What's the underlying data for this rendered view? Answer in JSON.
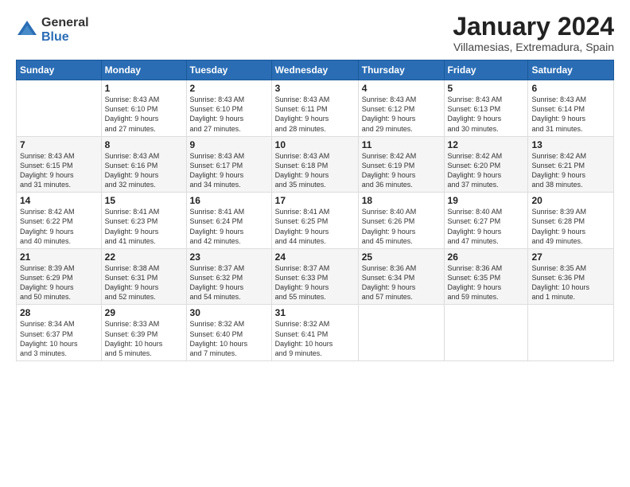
{
  "logo": {
    "general": "General",
    "blue": "Blue"
  },
  "title": "January 2024",
  "subtitle": "Villamesias, Extremadura, Spain",
  "weekdays": [
    "Sunday",
    "Monday",
    "Tuesday",
    "Wednesday",
    "Thursday",
    "Friday",
    "Saturday"
  ],
  "weeks": [
    [
      {
        "day": "",
        "info": ""
      },
      {
        "day": "1",
        "info": "Sunrise: 8:43 AM\nSunset: 6:10 PM\nDaylight: 9 hours\nand 27 minutes."
      },
      {
        "day": "2",
        "info": "Sunrise: 8:43 AM\nSunset: 6:10 PM\nDaylight: 9 hours\nand 27 minutes."
      },
      {
        "day": "3",
        "info": "Sunrise: 8:43 AM\nSunset: 6:11 PM\nDaylight: 9 hours\nand 28 minutes."
      },
      {
        "day": "4",
        "info": "Sunrise: 8:43 AM\nSunset: 6:12 PM\nDaylight: 9 hours\nand 29 minutes."
      },
      {
        "day": "5",
        "info": "Sunrise: 8:43 AM\nSunset: 6:13 PM\nDaylight: 9 hours\nand 30 minutes."
      },
      {
        "day": "6",
        "info": "Sunrise: 8:43 AM\nSunset: 6:14 PM\nDaylight: 9 hours\nand 31 minutes."
      }
    ],
    [
      {
        "day": "7",
        "info": "Sunrise: 8:43 AM\nSunset: 6:15 PM\nDaylight: 9 hours\nand 31 minutes."
      },
      {
        "day": "8",
        "info": "Sunrise: 8:43 AM\nSunset: 6:16 PM\nDaylight: 9 hours\nand 32 minutes."
      },
      {
        "day": "9",
        "info": "Sunrise: 8:43 AM\nSunset: 6:17 PM\nDaylight: 9 hours\nand 34 minutes."
      },
      {
        "day": "10",
        "info": "Sunrise: 8:43 AM\nSunset: 6:18 PM\nDaylight: 9 hours\nand 35 minutes."
      },
      {
        "day": "11",
        "info": "Sunrise: 8:42 AM\nSunset: 6:19 PM\nDaylight: 9 hours\nand 36 minutes."
      },
      {
        "day": "12",
        "info": "Sunrise: 8:42 AM\nSunset: 6:20 PM\nDaylight: 9 hours\nand 37 minutes."
      },
      {
        "day": "13",
        "info": "Sunrise: 8:42 AM\nSunset: 6:21 PM\nDaylight: 9 hours\nand 38 minutes."
      }
    ],
    [
      {
        "day": "14",
        "info": "Sunrise: 8:42 AM\nSunset: 6:22 PM\nDaylight: 9 hours\nand 40 minutes."
      },
      {
        "day": "15",
        "info": "Sunrise: 8:41 AM\nSunset: 6:23 PM\nDaylight: 9 hours\nand 41 minutes."
      },
      {
        "day": "16",
        "info": "Sunrise: 8:41 AM\nSunset: 6:24 PM\nDaylight: 9 hours\nand 42 minutes."
      },
      {
        "day": "17",
        "info": "Sunrise: 8:41 AM\nSunset: 6:25 PM\nDaylight: 9 hours\nand 44 minutes."
      },
      {
        "day": "18",
        "info": "Sunrise: 8:40 AM\nSunset: 6:26 PM\nDaylight: 9 hours\nand 45 minutes."
      },
      {
        "day": "19",
        "info": "Sunrise: 8:40 AM\nSunset: 6:27 PM\nDaylight: 9 hours\nand 47 minutes."
      },
      {
        "day": "20",
        "info": "Sunrise: 8:39 AM\nSunset: 6:28 PM\nDaylight: 9 hours\nand 49 minutes."
      }
    ],
    [
      {
        "day": "21",
        "info": "Sunrise: 8:39 AM\nSunset: 6:29 PM\nDaylight: 9 hours\nand 50 minutes."
      },
      {
        "day": "22",
        "info": "Sunrise: 8:38 AM\nSunset: 6:31 PM\nDaylight: 9 hours\nand 52 minutes."
      },
      {
        "day": "23",
        "info": "Sunrise: 8:37 AM\nSunset: 6:32 PM\nDaylight: 9 hours\nand 54 minutes."
      },
      {
        "day": "24",
        "info": "Sunrise: 8:37 AM\nSunset: 6:33 PM\nDaylight: 9 hours\nand 55 minutes."
      },
      {
        "day": "25",
        "info": "Sunrise: 8:36 AM\nSunset: 6:34 PM\nDaylight: 9 hours\nand 57 minutes."
      },
      {
        "day": "26",
        "info": "Sunrise: 8:36 AM\nSunset: 6:35 PM\nDaylight: 9 hours\nand 59 minutes."
      },
      {
        "day": "27",
        "info": "Sunrise: 8:35 AM\nSunset: 6:36 PM\nDaylight: 10 hours\nand 1 minute."
      }
    ],
    [
      {
        "day": "28",
        "info": "Sunrise: 8:34 AM\nSunset: 6:37 PM\nDaylight: 10 hours\nand 3 minutes."
      },
      {
        "day": "29",
        "info": "Sunrise: 8:33 AM\nSunset: 6:39 PM\nDaylight: 10 hours\nand 5 minutes."
      },
      {
        "day": "30",
        "info": "Sunrise: 8:32 AM\nSunset: 6:40 PM\nDaylight: 10 hours\nand 7 minutes."
      },
      {
        "day": "31",
        "info": "Sunrise: 8:32 AM\nSunset: 6:41 PM\nDaylight: 10 hours\nand 9 minutes."
      },
      {
        "day": "",
        "info": ""
      },
      {
        "day": "",
        "info": ""
      },
      {
        "day": "",
        "info": ""
      }
    ]
  ]
}
